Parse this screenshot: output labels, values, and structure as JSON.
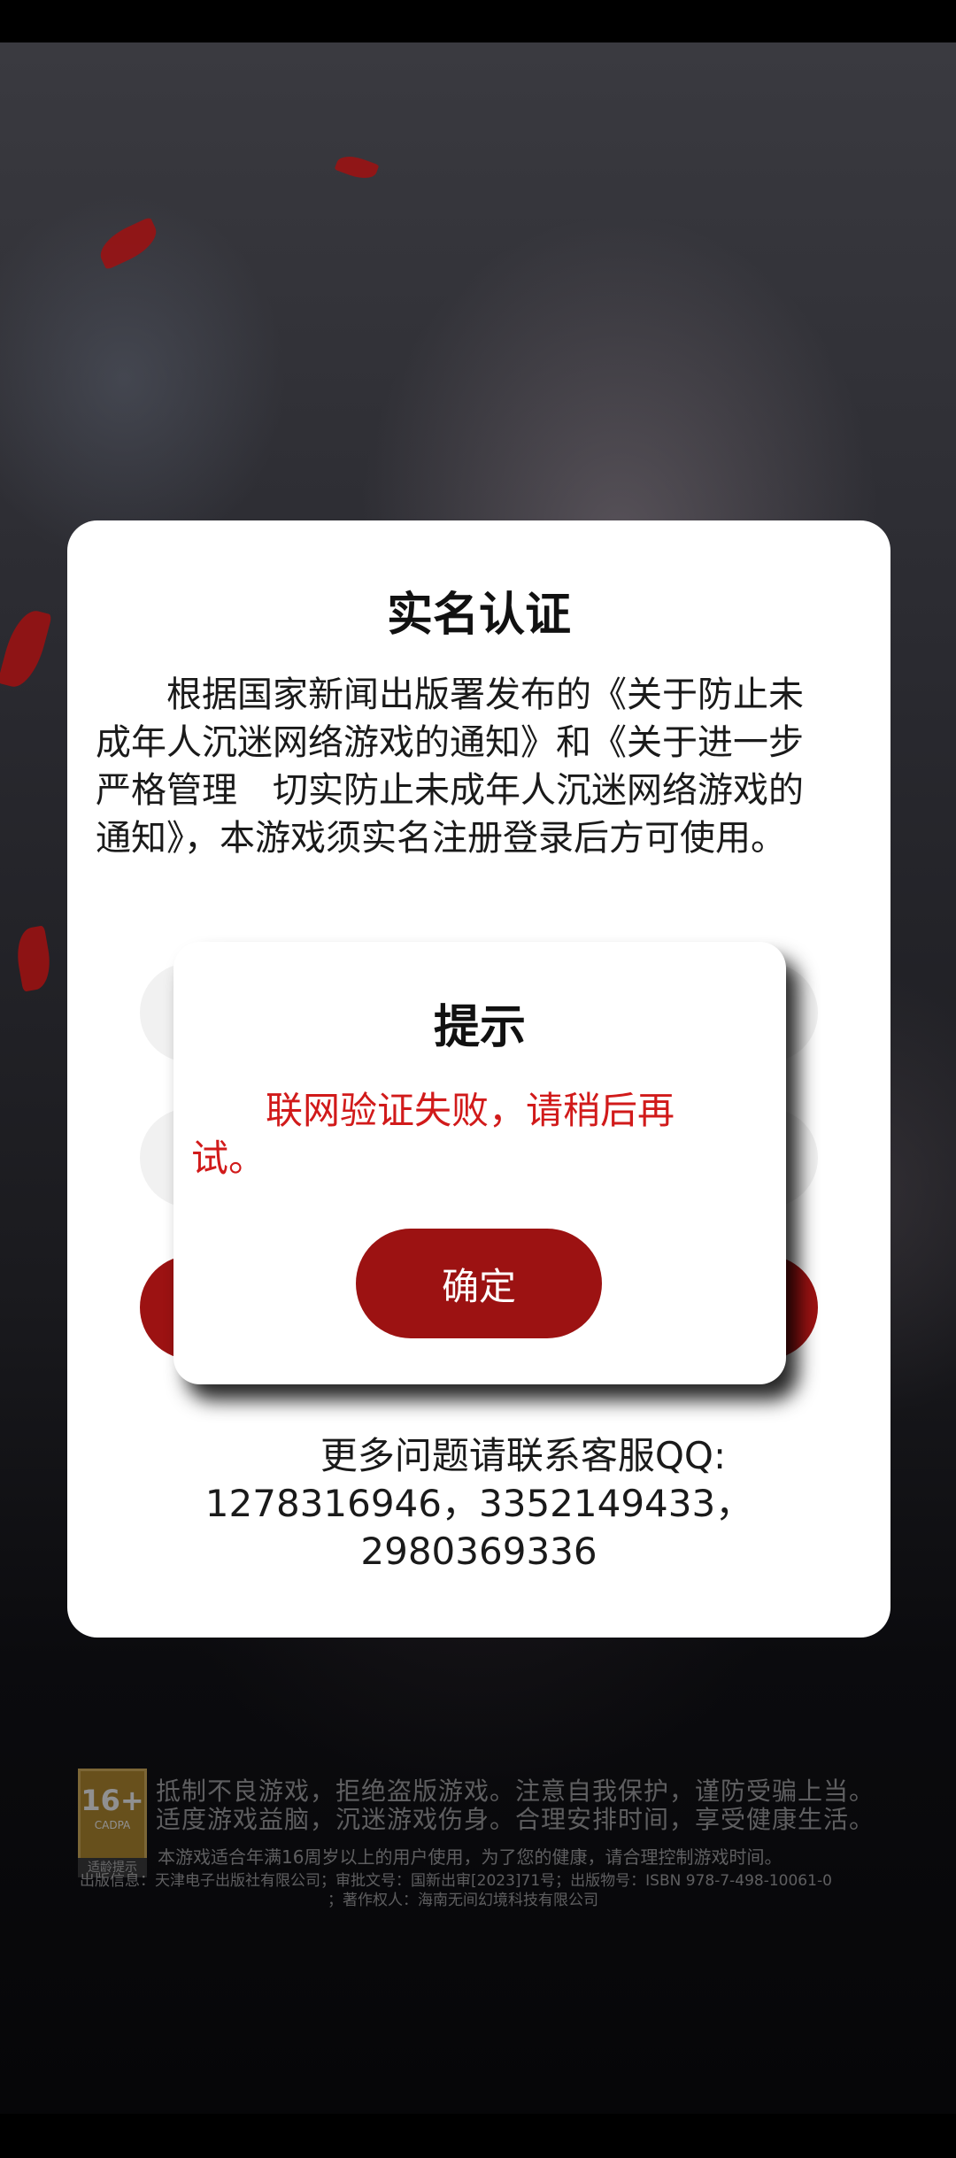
{
  "dialog": {
    "title": "实名认证",
    "body": "根据国家新闻出版署发布的《关于防止未成年人沉迷网络游戏的通知》和《关于进一步严格管理　切实防止未成年人沉迷网络游戏的通知》，本游戏须实名注册登录后方可使用。",
    "support_line1": "更多问题请联系客服QQ:",
    "support_line2": "1278316946，3352149433，",
    "support_line3": "2980369336"
  },
  "alert": {
    "title": "提示",
    "message": "联网验证失败，请稍后再试。",
    "confirm_label": "确定"
  },
  "age_rating": {
    "age": "16+",
    "org": "CADPA",
    "label": "适龄提示"
  },
  "notices": {
    "line1": "抵制不良游戏，拒绝盗版游戏。注意自我保护，谨防受骗上当。",
    "line2": "适度游戏益脑，沉迷游戏伤身。合理安排时间，享受健康生活。",
    "line3": "本游戏适合年满16周岁以上的用户使用，为了您的健康，请合理控制游戏时间。",
    "line4": "出版信息：天津电子出版社有限公司；审批文号：国新出审[2023]71号；出版物号：ISBN 978-7-498-10061-0",
    "line5": "；著作权人：海南无间幻境科技有限公司"
  },
  "colors": {
    "accent": "#9c1212",
    "error_text": "#d11a1a"
  }
}
